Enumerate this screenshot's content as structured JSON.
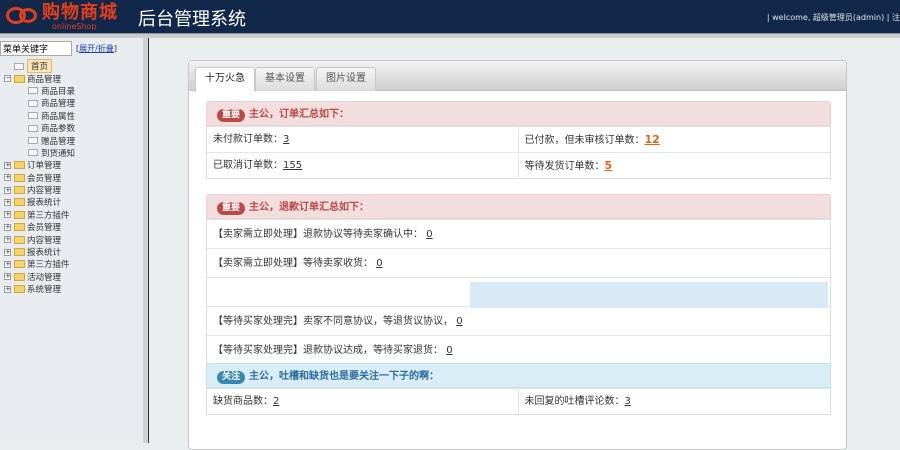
{
  "header": {
    "brand": "购物商城",
    "brand_sub": "onlineShop",
    "title": "后台管理系统",
    "user_text": "| welcome, 超级管理员(admin) | 注"
  },
  "sidebar": {
    "search_value": "菜单关键字",
    "toggle": "展开/折叠",
    "home": "首页",
    "groups": [
      {
        "label": "商品管理",
        "expanded": true,
        "children": [
          "商品目录",
          "商品管理",
          "商品属性",
          "商品参数",
          "赠品管理",
          "到货通知"
        ]
      },
      {
        "label": "订单管理"
      },
      {
        "label": "会员管理"
      },
      {
        "label": "内容管理"
      },
      {
        "label": "报表统计"
      },
      {
        "label": "第三方插件"
      },
      {
        "label": "会员管理"
      },
      {
        "label": "内容管理"
      },
      {
        "label": "报表统计"
      },
      {
        "label": "第三方插件"
      },
      {
        "label": "活动管理"
      },
      {
        "label": "系统管理"
      }
    ]
  },
  "tabs": [
    "十万火急",
    "基本设置",
    "图片设置"
  ],
  "orders": {
    "badge": "重要",
    "title": "主公，订单汇总如下：",
    "cells": [
      {
        "label": "未付款订单数：",
        "value": "3"
      },
      {
        "label": "已付款，但未审核订单数：",
        "value": "12",
        "hot": true
      },
      {
        "label": "已取消订单数：",
        "value": "155"
      },
      {
        "label": "等待发货订单数：",
        "value": "5",
        "hot": true
      }
    ]
  },
  "refunds": {
    "badge": "重要",
    "title": "主公，退款订单汇总如下：",
    "rows": [
      {
        "label": "【卖家需立即处理】退款协议等待卖家确认中：",
        "value": "0"
      },
      {
        "label": "【卖家需立即处理】等待卖家收货：",
        "value": "0"
      },
      {
        "label": "",
        "value": ""
      },
      {
        "label": "【等待买家处理完】卖家不同意协议，等退货议协议，",
        "value": "0"
      },
      {
        "label": "【等待买家处理完】退款协议达成，等待买家退货：",
        "value": "0"
      }
    ]
  },
  "attention": {
    "badge": "关注",
    "title": "主公，吐槽和缺货也是要关注一下子的啊：",
    "cells": [
      {
        "label": "缺货商品数：",
        "value": "2"
      },
      {
        "label": "未回复的吐槽评论数：",
        "value": "3"
      }
    ]
  }
}
